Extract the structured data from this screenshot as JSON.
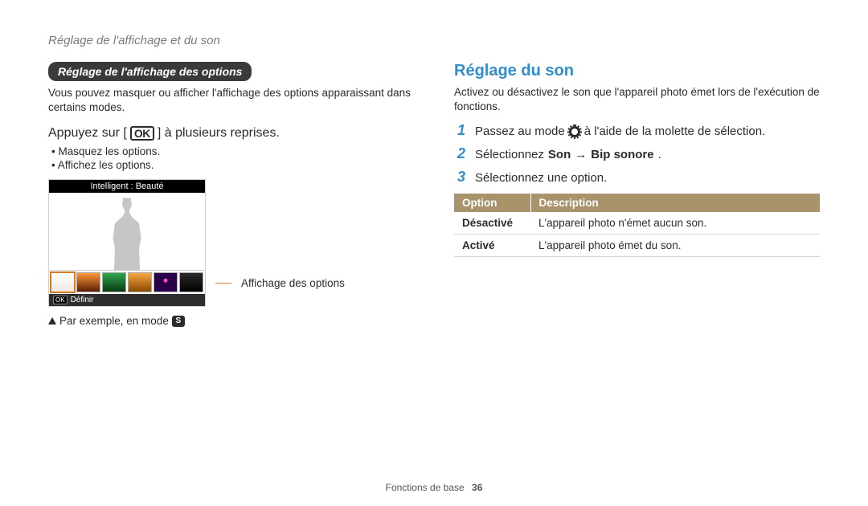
{
  "page_header": "Réglage de l'affichage et du son",
  "left": {
    "pill": "Réglage de l'affichage des options",
    "intro": "Vous pouvez masquer ou afficher l'affichage des options apparaissant dans certains modes.",
    "instruction_pre": "Appuyez sur [",
    "instruction_key": "OK",
    "instruction_post": "] à plusieurs reprises.",
    "bullets": [
      "Masquez les options.",
      "Affichez les options."
    ],
    "camera": {
      "top_label": "Intelligent : Beauté",
      "bottom_key": "OK",
      "bottom_label": "Définir"
    },
    "callout": "Affichage des options",
    "example_text": "Par exemple, en mode",
    "example_mode": "S"
  },
  "right": {
    "title": "Réglage du son",
    "intro": "Activez ou désactivez le son que l'appareil photo émet lors de l'exécution de fonctions.",
    "steps": [
      {
        "n": "1",
        "pre": "Passez au mode",
        "icon": "gear",
        "post": "à l'aide de la molette de sélection."
      },
      {
        "n": "2",
        "pre": "Sélectionnez",
        "bold1": "Son",
        "arrow": "→",
        "bold2": "Bip sonore",
        "post": "."
      },
      {
        "n": "3",
        "pre": "Sélectionnez une option.",
        "post": ""
      }
    ],
    "table": {
      "head": [
        "Option",
        "Description"
      ],
      "rows": [
        [
          "Désactivé",
          "L'appareil photo n'émet aucun son."
        ],
        [
          "Activé",
          "L'appareil photo émet du son."
        ]
      ]
    }
  },
  "footer": {
    "section": "Fonctions de base",
    "page": "36"
  }
}
